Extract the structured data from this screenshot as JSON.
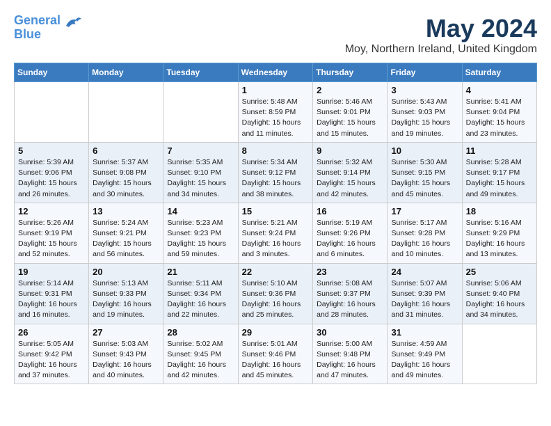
{
  "app": {
    "logo_line1": "General",
    "logo_line2": "Blue"
  },
  "header": {
    "title": "May 2024",
    "subtitle": "Moy, Northern Ireland, United Kingdom"
  },
  "calendar": {
    "days_of_week": [
      "Sunday",
      "Monday",
      "Tuesday",
      "Wednesday",
      "Thursday",
      "Friday",
      "Saturday"
    ],
    "weeks": [
      [
        {
          "day": "",
          "info": ""
        },
        {
          "day": "",
          "info": ""
        },
        {
          "day": "",
          "info": ""
        },
        {
          "day": "1",
          "info": "Sunrise: 5:48 AM\nSunset: 8:59 PM\nDaylight: 15 hours\nand 11 minutes."
        },
        {
          "day": "2",
          "info": "Sunrise: 5:46 AM\nSunset: 9:01 PM\nDaylight: 15 hours\nand 15 minutes."
        },
        {
          "day": "3",
          "info": "Sunrise: 5:43 AM\nSunset: 9:03 PM\nDaylight: 15 hours\nand 19 minutes."
        },
        {
          "day": "4",
          "info": "Sunrise: 5:41 AM\nSunset: 9:04 PM\nDaylight: 15 hours\nand 23 minutes."
        }
      ],
      [
        {
          "day": "5",
          "info": "Sunrise: 5:39 AM\nSunset: 9:06 PM\nDaylight: 15 hours\nand 26 minutes."
        },
        {
          "day": "6",
          "info": "Sunrise: 5:37 AM\nSunset: 9:08 PM\nDaylight: 15 hours\nand 30 minutes."
        },
        {
          "day": "7",
          "info": "Sunrise: 5:35 AM\nSunset: 9:10 PM\nDaylight: 15 hours\nand 34 minutes."
        },
        {
          "day": "8",
          "info": "Sunrise: 5:34 AM\nSunset: 9:12 PM\nDaylight: 15 hours\nand 38 minutes."
        },
        {
          "day": "9",
          "info": "Sunrise: 5:32 AM\nSunset: 9:14 PM\nDaylight: 15 hours\nand 42 minutes."
        },
        {
          "day": "10",
          "info": "Sunrise: 5:30 AM\nSunset: 9:15 PM\nDaylight: 15 hours\nand 45 minutes."
        },
        {
          "day": "11",
          "info": "Sunrise: 5:28 AM\nSunset: 9:17 PM\nDaylight: 15 hours\nand 49 minutes."
        }
      ],
      [
        {
          "day": "12",
          "info": "Sunrise: 5:26 AM\nSunset: 9:19 PM\nDaylight: 15 hours\nand 52 minutes."
        },
        {
          "day": "13",
          "info": "Sunrise: 5:24 AM\nSunset: 9:21 PM\nDaylight: 15 hours\nand 56 minutes."
        },
        {
          "day": "14",
          "info": "Sunrise: 5:23 AM\nSunset: 9:23 PM\nDaylight: 15 hours\nand 59 minutes."
        },
        {
          "day": "15",
          "info": "Sunrise: 5:21 AM\nSunset: 9:24 PM\nDaylight: 16 hours\nand 3 minutes."
        },
        {
          "day": "16",
          "info": "Sunrise: 5:19 AM\nSunset: 9:26 PM\nDaylight: 16 hours\nand 6 minutes."
        },
        {
          "day": "17",
          "info": "Sunrise: 5:17 AM\nSunset: 9:28 PM\nDaylight: 16 hours\nand 10 minutes."
        },
        {
          "day": "18",
          "info": "Sunrise: 5:16 AM\nSunset: 9:29 PM\nDaylight: 16 hours\nand 13 minutes."
        }
      ],
      [
        {
          "day": "19",
          "info": "Sunrise: 5:14 AM\nSunset: 9:31 PM\nDaylight: 16 hours\nand 16 minutes."
        },
        {
          "day": "20",
          "info": "Sunrise: 5:13 AM\nSunset: 9:33 PM\nDaylight: 16 hours\nand 19 minutes."
        },
        {
          "day": "21",
          "info": "Sunrise: 5:11 AM\nSunset: 9:34 PM\nDaylight: 16 hours\nand 22 minutes."
        },
        {
          "day": "22",
          "info": "Sunrise: 5:10 AM\nSunset: 9:36 PM\nDaylight: 16 hours\nand 25 minutes."
        },
        {
          "day": "23",
          "info": "Sunrise: 5:08 AM\nSunset: 9:37 PM\nDaylight: 16 hours\nand 28 minutes."
        },
        {
          "day": "24",
          "info": "Sunrise: 5:07 AM\nSunset: 9:39 PM\nDaylight: 16 hours\nand 31 minutes."
        },
        {
          "day": "25",
          "info": "Sunrise: 5:06 AM\nSunset: 9:40 PM\nDaylight: 16 hours\nand 34 minutes."
        }
      ],
      [
        {
          "day": "26",
          "info": "Sunrise: 5:05 AM\nSunset: 9:42 PM\nDaylight: 16 hours\nand 37 minutes."
        },
        {
          "day": "27",
          "info": "Sunrise: 5:03 AM\nSunset: 9:43 PM\nDaylight: 16 hours\nand 40 minutes."
        },
        {
          "day": "28",
          "info": "Sunrise: 5:02 AM\nSunset: 9:45 PM\nDaylight: 16 hours\nand 42 minutes."
        },
        {
          "day": "29",
          "info": "Sunrise: 5:01 AM\nSunset: 9:46 PM\nDaylight: 16 hours\nand 45 minutes."
        },
        {
          "day": "30",
          "info": "Sunrise: 5:00 AM\nSunset: 9:48 PM\nDaylight: 16 hours\nand 47 minutes."
        },
        {
          "day": "31",
          "info": "Sunrise: 4:59 AM\nSunset: 9:49 PM\nDaylight: 16 hours\nand 49 minutes."
        },
        {
          "day": "",
          "info": ""
        }
      ]
    ]
  }
}
